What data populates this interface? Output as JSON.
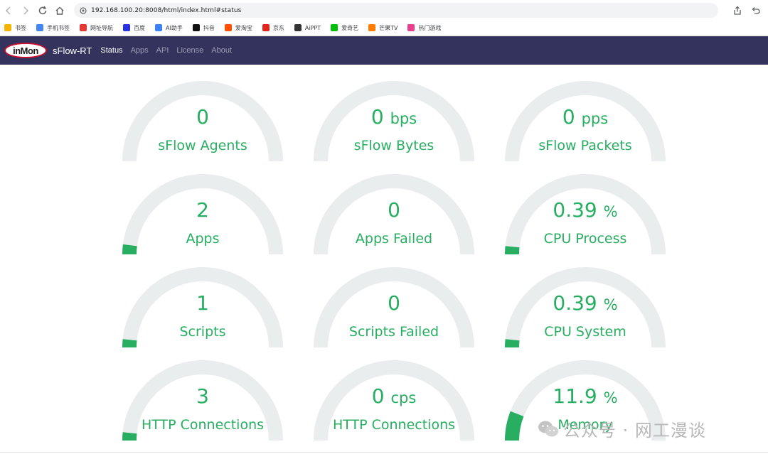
{
  "browser": {
    "url": "192.168.100.20:8008/html/index.html#status",
    "bookmarks": [
      {
        "label": "书签",
        "color": "#f4b400"
      },
      {
        "label": "手机书签",
        "color": "#4285f4"
      },
      {
        "label": "网址导航",
        "color": "#e53935"
      },
      {
        "label": "百度",
        "color": "#2932e1"
      },
      {
        "label": "AI助手",
        "color": "#3b82f6"
      },
      {
        "label": "抖音",
        "color": "#111111"
      },
      {
        "label": "爱淘宝",
        "color": "#ff5000"
      },
      {
        "label": "京东",
        "color": "#e1251b"
      },
      {
        "label": "AiPPT",
        "color": "#333333"
      },
      {
        "label": "爱奇艺",
        "color": "#00be06"
      },
      {
        "label": "芒果TV",
        "color": "#ff7e00"
      },
      {
        "label": "热门游戏",
        "color": "#e83e8c"
      }
    ]
  },
  "navbar": {
    "logo": "inMon",
    "brand": "sFlow-RT",
    "links": [
      "Status",
      "Apps",
      "API",
      "License",
      "About"
    ],
    "active": "Status"
  },
  "colors": {
    "gauge_track": "#e9eded",
    "gauge_fill": "#27ae60",
    "nav_bg": "#34335d"
  },
  "gauges": [
    {
      "value": "0",
      "unit": "",
      "label": "sFlow Agents",
      "fill": 0
    },
    {
      "value": "0",
      "unit": "bps",
      "label": "sFlow Bytes",
      "fill": 0
    },
    {
      "value": "0",
      "unit": "pps",
      "label": "sFlow Packets",
      "fill": 0
    },
    {
      "value": "2",
      "unit": "",
      "label": "Apps",
      "fill": 0.04
    },
    {
      "value": "0",
      "unit": "",
      "label": "Apps Failed",
      "fill": 0
    },
    {
      "value": "0.39",
      "unit": "%",
      "label": "CPU Process",
      "fill": 0.0039
    },
    {
      "value": "1",
      "unit": "",
      "label": "Scripts",
      "fill": 0.02
    },
    {
      "value": "0",
      "unit": "",
      "label": "Scripts Failed",
      "fill": 0
    },
    {
      "value": "0.39",
      "unit": "%",
      "label": "CPU System",
      "fill": 0.0039
    },
    {
      "value": "3",
      "unit": "",
      "label": "HTTP Connections",
      "fill": 0.03
    },
    {
      "value": "0",
      "unit": "cps",
      "label": "HTTP Connections",
      "fill": 0
    },
    {
      "value": "11.9",
      "unit": "%",
      "label": "Memory",
      "fill": 0.119
    }
  ],
  "watermark": {
    "text": "公众号 · 网工漫谈"
  }
}
